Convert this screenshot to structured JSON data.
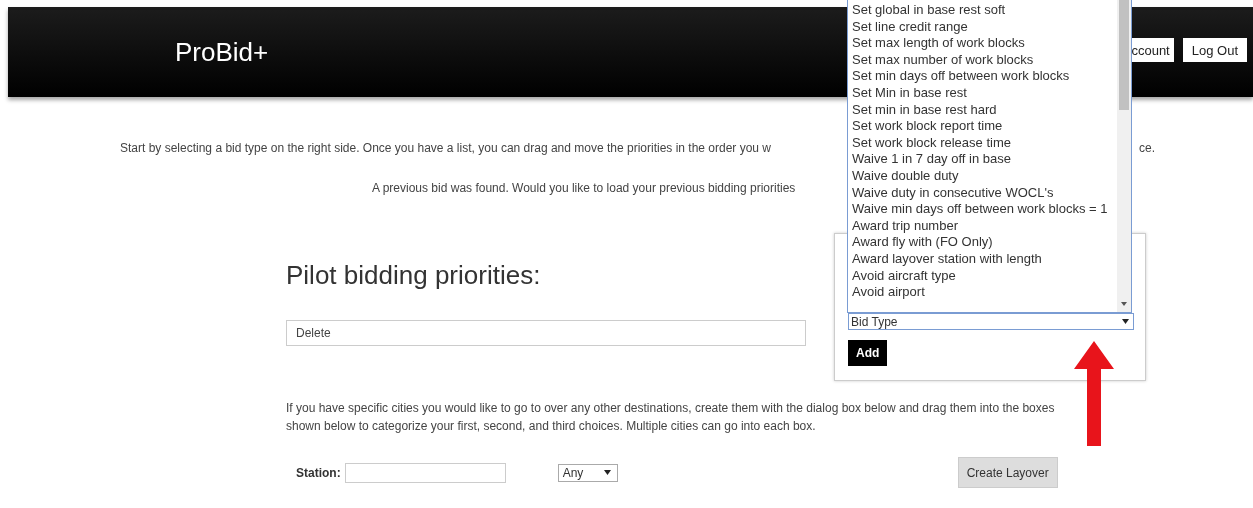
{
  "header": {
    "title": "ProBid+",
    "nav": [
      "ccount",
      "Log Out"
    ]
  },
  "intro": {
    "text": "Start by selecting a bid type on the right side. Once you have a list, you can drag and move the priorities in the order you w",
    "tail": "ce."
  },
  "previous_bid": {
    "text": "A previous bid was found. Would you like to load your previous bidding priorities"
  },
  "priorities": {
    "heading": "Pilot bidding priorities:",
    "items": [
      {
        "label": "Delete"
      }
    ]
  },
  "bid_panel": {
    "select": {
      "value": "Bid Type",
      "expanded": true
    },
    "button": "Add",
    "options": [
      {
        "label": "Set global in base rest soft",
        "selected": false
      },
      {
        "label": "Set line credit range",
        "selected": false
      },
      {
        "label": "Set max length of work blocks",
        "selected": false
      },
      {
        "label": "Set max number of work blocks",
        "selected": false
      },
      {
        "label": "Set min days off between work blocks",
        "selected": false
      },
      {
        "label": "Set Min in base rest",
        "selected": false
      },
      {
        "label": "Set min in base rest hard",
        "selected": false
      },
      {
        "label": "Set work block report time",
        "selected": false
      },
      {
        "label": "Set work block release time",
        "selected": false
      },
      {
        "label": "Waive 1 in 7 day off in base",
        "selected": false
      },
      {
        "label": "Waive double duty",
        "selected": false
      },
      {
        "label": "Waive duty in consecutive WOCL's",
        "selected": false
      },
      {
        "label": "Waive min days off between work blocks = 1",
        "selected": false
      },
      {
        "label": "Award trip number",
        "selected": false
      },
      {
        "label": "Award fly with (FO Only)",
        "selected": false
      },
      {
        "label": "Award layover station with length",
        "selected": false
      },
      {
        "label": "Avoid aircraft type",
        "selected": false
      },
      {
        "label": "Avoid airport",
        "selected": false
      }
    ]
  },
  "cities": {
    "text": "If you have specific cities you would like to go to over any other destinations, create them with the dialog box below and drag them into the boxes shown below to categorize your first, second, and third choices. Multiple cities can go into each box.",
    "station_label": "Station:",
    "length_select": "Any",
    "button": "Create Layover"
  }
}
